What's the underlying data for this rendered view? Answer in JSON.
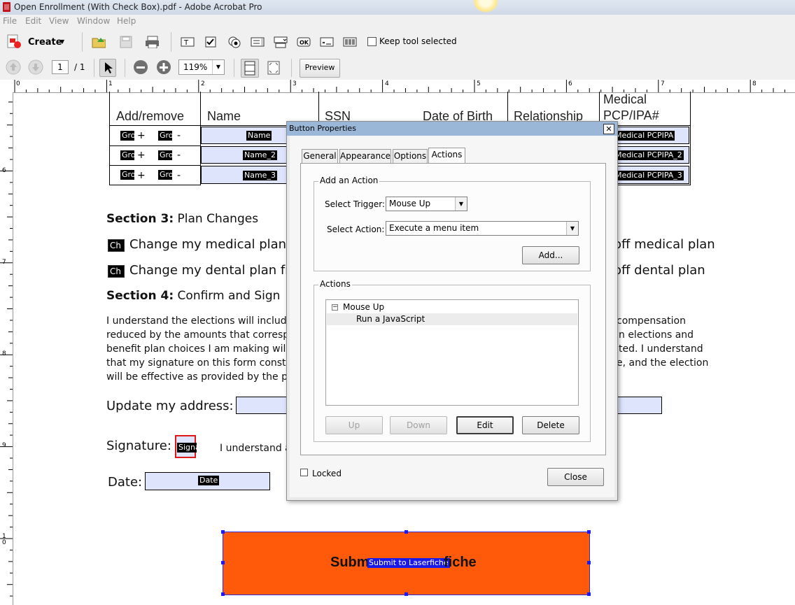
{
  "window": {
    "title": "Open Enrollment (With Check Box).pdf - Adobe Acrobat Pro"
  },
  "menu": [
    "File",
    "Edit",
    "View",
    "Window",
    "Help"
  ],
  "toolbar": {
    "create_label": "Create",
    "keep_tool_label": "Keep tool selected",
    "page_current": "1",
    "page_total": "/ 1",
    "zoom": "119%",
    "preview_label": "Preview"
  },
  "ruler": {
    "marks": [
      "0",
      "1",
      "2",
      "3",
      "4",
      "5",
      "6",
      "7",
      "8"
    ],
    "vmarks": [
      "6",
      "7",
      "8",
      "9",
      "1\n0"
    ]
  },
  "table": {
    "headers": [
      "Add/remove",
      "Name",
      "SSN",
      "Date of Birth",
      "Relationship",
      "Medical\nPCP/IPA#"
    ],
    "rows": [
      {
        "add": "Gro",
        "remove": "Gro",
        "name": "Name",
        "pcp": "Medical PCPIPA"
      },
      {
        "add": "Gro",
        "remove": "Gro",
        "name": "Name_2",
        "pcp": "Medical PCPIPA_2"
      },
      {
        "add": "Gro",
        "remove": "Gro",
        "name": "Name_3",
        "pcp": "Medical PCPIPA_3"
      }
    ],
    "plus": "+",
    "minus": "-"
  },
  "section3": {
    "heading_bold": "Section 3:",
    "heading_rest": " Plan Changes",
    "items": [
      {
        "check": "Ch",
        "text_left": "Change my medical plan fro",
        "text_right": "off medical plan"
      },
      {
        "check": "Ch",
        "text_left": "Change my dental plan from",
        "text_right": "off dental plan"
      }
    ]
  },
  "section4": {
    "heading_bold": "Section 4:",
    "heading_rest": " Confirm and Sign",
    "para_left": [
      "I understand the elections will include",
      "reduced by the amounts that correspo",
      "benefit plan choices I am making will r",
      "that my signature on this form constitu",
      "will be effective as provided by the pla"
    ],
    "para_right": [
      "compensation",
      "n elections and",
      "ted. I understand",
      "e, and the election",
      ""
    ]
  },
  "address_label": "Update my address:",
  "signature": {
    "label": "Signature:",
    "field": "Signa",
    "note": "I understand a"
  },
  "date": {
    "label": "Date:",
    "field": "Date"
  },
  "submit": {
    "text_left": "Subm",
    "field": "Submit to Laserfiche",
    "text_right": "fiche"
  },
  "dialog": {
    "title": "Button Properties",
    "close_x": "✕",
    "tabs": [
      "General",
      "Appearance",
      "Options",
      "Actions"
    ],
    "active_tab": "Actions",
    "add_action_group": "Add an Action",
    "trigger_label": "Select Trigger:",
    "trigger_value": "Mouse Up",
    "action_label": "Select Action:",
    "action_value": "Execute a menu item",
    "add_button": "Add...",
    "actions_group": "Actions",
    "tree": {
      "parent": "Mouse Up",
      "toggle": "−",
      "child": "Run a JavaScript"
    },
    "buttons": {
      "up": "Up",
      "down": "Down",
      "edit": "Edit",
      "delete": "Delete"
    },
    "locked_label": "Locked",
    "close_button": "Close"
  },
  "colors": {
    "field_fill": "#dde4fb",
    "submit_fill": "#ff5a0a",
    "dialog_title": "#9bb7d7"
  }
}
